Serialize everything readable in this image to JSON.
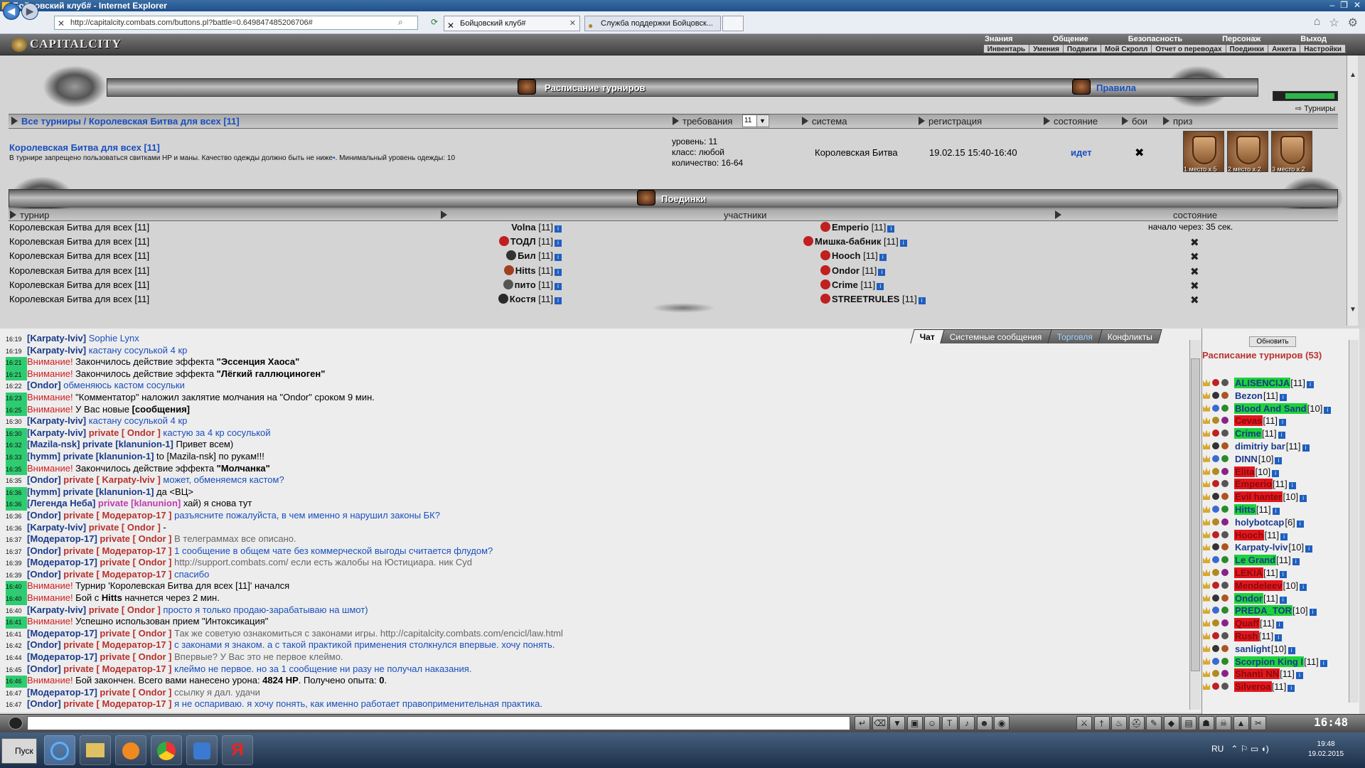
{
  "window": {
    "title": "Бойцовский клуб# - Internet Explorer",
    "controls": [
      "–",
      "❐",
      "✕"
    ]
  },
  "browser": {
    "url": "http://capitalcity.combats.com/buttons.pl?battle=0.649847485206706#",
    "tabs": [
      {
        "label": "Бойцовский клуб#",
        "close": "✕"
      },
      {
        "label": "Служба поддержки Бойцовск..."
      }
    ],
    "icons": [
      "back-icon",
      "forward-icon",
      "home-icon",
      "favorites-icon",
      "settings-icon"
    ]
  },
  "game": {
    "logo": "CAPITALCITY",
    "menu_top": [
      "Знания",
      "Общение",
      "Безопасность",
      "Персонаж",
      "Выход"
    ],
    "menu_sub": [
      "Инвентарь",
      "Умения",
      "Подвиги",
      "Мой Скролл",
      "Отчет о переводах",
      "Поединки",
      "Анкета",
      "Настройки"
    ],
    "schedule_title": "Расписание турниров",
    "rules": "Правила",
    "tournaments_link": "Турниры",
    "progress": 0.78,
    "header": {
      "crumb": "Все турниры / Королевская Битва для всех [11]",
      "requirements": "требования",
      "req_value": "11",
      "system": "система",
      "registration": "регистрация",
      "state": "состояние",
      "battles": "бои",
      "prize": "приз"
    },
    "tournament": {
      "name": "Королевская Битва для всех [11]",
      "desc": "В турнире запрещено пользоваться свитками HP и маны. Качество одежды должно быть не ниже",
      "desc2": ". Минимальный уровень одежды: 10",
      "level": "уровень: 11",
      "class": "класс: любой",
      "count": "количество: 16-64",
      "system": "Королевская Битва",
      "registration": "19.02.15 15:40-16:40",
      "state": "идет",
      "prizes": [
        "1 место",
        "2 место",
        "3 место"
      ],
      "prize_counts": [
        "x 5",
        "x 2",
        "x 2"
      ]
    },
    "duels": {
      "title": "Поединки",
      "headers": {
        "tournament": "турнир",
        "participants": "участники",
        "state": "состояние"
      },
      "rows": [
        {
          "t": "Королевская Битва для всех [11]",
          "a": "Volna",
          "al": "[11]",
          "b": "Emperio",
          "bl": "[11]",
          "state": "начало через: 35 сек."
        },
        {
          "t": "Королевская Битва для всех [11]",
          "a": "ТОДЛ",
          "al": "[11]",
          "b": "Мишка-бабник",
          "bl": "[11]",
          "state": "✖"
        },
        {
          "t": "Королевская Битва для всех [11]",
          "a": "Бил",
          "al": "[11]",
          "b": "Hooch",
          "bl": "[11]",
          "state": "✖"
        },
        {
          "t": "Королевская Битва для всех [11]",
          "a": "Hitts",
          "al": "[11]",
          "b": "Ondor",
          "bl": "[11]",
          "state": "✖"
        },
        {
          "t": "Королевская Битва для всех [11]",
          "a": "пито",
          "al": "[11]",
          "b": "Crime",
          "bl": "[11]",
          "state": "✖"
        },
        {
          "t": "Королевская Битва для всех [11]",
          "a": "Костя",
          "al": "[11]",
          "b": "STREETRULES",
          "bl": "[11]",
          "state": "✖"
        }
      ]
    }
  },
  "chat": {
    "tabs": [
      "Чат",
      "Системные сообщения",
      "Торговля",
      "Конфликты"
    ],
    "lines": [
      {
        "ts": "16:19",
        "hl": false,
        "parts": [
          [
            "nick",
            "[Karpaty-lviv]"
          ],
          [
            "bl",
            " Sophie Lynx"
          ]
        ]
      },
      {
        "ts": "16:19",
        "hl": false,
        "parts": [
          [
            "nick",
            "[Karpaty-lviv]"
          ],
          [
            "bl",
            " кастану сосулькой 4 кр"
          ]
        ]
      },
      {
        "ts": "16:21",
        "hl": true,
        "parts": [
          [
            "warn",
            "Внимание!"
          ],
          [
            "t",
            " Закончилось действие эффекта "
          ],
          [
            "bold",
            "\"Эссенция Хаоса\""
          ]
        ]
      },
      {
        "ts": "16:21",
        "hl": true,
        "parts": [
          [
            "warn",
            "Внимание!"
          ],
          [
            "t",
            " Закончилось действие эффекта "
          ],
          [
            "bold",
            "\"Лёгкий галлюциноген\""
          ]
        ]
      },
      {
        "ts": "16:22",
        "hl": false,
        "parts": [
          [
            "nick",
            "[Ondor]"
          ],
          [
            "bl",
            " обменяюсь кастом сосульки"
          ]
        ]
      },
      {
        "ts": "16:23",
        "hl": true,
        "parts": [
          [
            "warn",
            "Внимание!"
          ],
          [
            "t",
            " \"Комментатор\" наложил заклятие молчания на \"Ondor\" сроком 9 мин."
          ]
        ]
      },
      {
        "ts": "16:25",
        "hl": true,
        "parts": [
          [
            "warn",
            "Внимание!"
          ],
          [
            "t",
            " У Вас новые "
          ],
          [
            "bold",
            "[сообщения]"
          ]
        ]
      },
      {
        "ts": "16:30",
        "hl": false,
        "parts": [
          [
            "nick",
            "[Karpaty-lviv]"
          ],
          [
            "bl",
            " кастану сосулькой 4 кр"
          ]
        ]
      },
      {
        "ts": "16:30",
        "hl": true,
        "parts": [
          [
            "nick",
            "[Karpaty-lviv]"
          ],
          [
            "pnick",
            " private [ Ondor ]"
          ],
          [
            "bl",
            " кастую за 4 кр сосулькой"
          ]
        ]
      },
      {
        "ts": "16:32",
        "hl": true,
        "parts": [
          [
            "nick",
            "[Mazila-nsk]"
          ],
          [
            "nick",
            " private [klanunion-1]"
          ],
          [
            "t",
            " Привет всем)"
          ]
        ]
      },
      {
        "ts": "16:33",
        "hl": true,
        "parts": [
          [
            "nick",
            "[hymm]"
          ],
          [
            "nick",
            " private [klanunion-1]"
          ],
          [
            "t",
            " to [Mazila-nsk] по рукам!!!"
          ]
        ]
      },
      {
        "ts": "16:35",
        "hl": true,
        "parts": [
          [
            "warn",
            "Внимание!"
          ],
          [
            "t",
            " Закончилось действие эффекта "
          ],
          [
            "bold",
            "\"Молчанка\""
          ]
        ]
      },
      {
        "ts": "16:35",
        "hl": false,
        "parts": [
          [
            "nick",
            "[Ondor]"
          ],
          [
            "pnick",
            " private [ Karpaty-lviv ]"
          ],
          [
            "bl",
            " может, обменяемся кастом?"
          ]
        ]
      },
      {
        "ts": "16:36",
        "hl": true,
        "parts": [
          [
            "nick",
            "[hymm]"
          ],
          [
            "nick",
            " private [klanunion-1]"
          ],
          [
            "t",
            " да <ВЦ>"
          ]
        ]
      },
      {
        "ts": "16:36",
        "hl": true,
        "parts": [
          [
            "nick",
            "[Легенда Неба]"
          ],
          [
            "pink",
            " private [klanunion]"
          ],
          [
            "t",
            " хай) я снова тут"
          ]
        ]
      },
      {
        "ts": "16:36",
        "hl": false,
        "parts": [
          [
            "nick",
            "[Ondor]"
          ],
          [
            "pnick",
            " private [ Модератор-17 ]"
          ],
          [
            "bl",
            " разъясните пожалуйста, в чем именно я нарушил законы БК?"
          ]
        ]
      },
      {
        "ts": "16:36",
        "hl": false,
        "parts": [
          [
            "nick",
            "[Karpaty-lviv]"
          ],
          [
            "pnick",
            " private [ Ondor ]"
          ],
          [
            "t",
            " -"
          ]
        ]
      },
      {
        "ts": "16:37",
        "hl": false,
        "parts": [
          [
            "nick",
            "[Модератор-17]"
          ],
          [
            "pnick",
            " private [ Ondor ]"
          ],
          [
            "gray",
            " В телеграммах все описано."
          ]
        ]
      },
      {
        "ts": "16:37",
        "hl": false,
        "parts": [
          [
            "nick",
            "[Ondor]"
          ],
          [
            "pnick",
            " private [ Модератор-17 ]"
          ],
          [
            "bl",
            " 1 сообщение в общем чате без коммерческой выгоды считается флудом?"
          ]
        ]
      },
      {
        "ts": "16:39",
        "hl": false,
        "parts": [
          [
            "nick",
            "[Модератор-17]"
          ],
          [
            "pnick",
            " private [ Ondor ]"
          ],
          [
            "gray",
            " http://support.combats.com/ если есть жалобы на Юстициара. ник Cyd"
          ]
        ]
      },
      {
        "ts": "16:39",
        "hl": false,
        "parts": [
          [
            "nick",
            "[Ondor]"
          ],
          [
            "pnick",
            " private [ Модератор-17 ]"
          ],
          [
            "bl",
            " спасибо"
          ]
        ]
      },
      {
        "ts": "16:40",
        "hl": true,
        "parts": [
          [
            "warn",
            "Внимание!"
          ],
          [
            "t",
            " Турнир 'Королевская Битва для всех [11]' начался"
          ]
        ]
      },
      {
        "ts": "16:40",
        "hl": true,
        "parts": [
          [
            "warn",
            "Внимание!"
          ],
          [
            "t",
            " Бой с "
          ],
          [
            "bold",
            "Hitts"
          ],
          [
            "t",
            " начнется через 2 мин."
          ]
        ]
      },
      {
        "ts": "16:40",
        "hl": false,
        "parts": [
          [
            "nick",
            "[Karpaty-lviv]"
          ],
          [
            "pnick",
            " private [ Ondor ]"
          ],
          [
            "bl",
            " просто я только продаю-зарабатываю на шмот)"
          ]
        ]
      },
      {
        "ts": "16:41",
        "hl": true,
        "parts": [
          [
            "warn",
            "Внимание!"
          ],
          [
            "t",
            " Успешно использован прием \"Интоксикация\""
          ]
        ]
      },
      {
        "ts": "16:41",
        "hl": false,
        "parts": [
          [
            "nick",
            "[Модератор-17]"
          ],
          [
            "pnick",
            " private [ Ondor ]"
          ],
          [
            "gray",
            " Так же советую ознакомиться с законами игры. http://capitalcity.combats.com/encicl/law.html"
          ]
        ]
      },
      {
        "ts": "16:42",
        "hl": false,
        "parts": [
          [
            "nick",
            "[Ondor]"
          ],
          [
            "pnick",
            " private [ Модератор-17 ]"
          ],
          [
            "bl",
            " с законами я знаком. а с такой практикой применения столкнулся впервые. хочу понять."
          ]
        ]
      },
      {
        "ts": "16:44",
        "hl": false,
        "parts": [
          [
            "nick",
            "[Модератор-17]"
          ],
          [
            "pnick",
            " private [ Ondor ]"
          ],
          [
            "gray",
            " Впервые? У Вас это не первое клеймо."
          ]
        ]
      },
      {
        "ts": "16:45",
        "hl": false,
        "parts": [
          [
            "nick",
            "[Ondor]"
          ],
          [
            "pnick",
            " private [ Модератор-17 ]"
          ],
          [
            "bl",
            " клеймо не первое. но за 1 сообщение ни разу не получал наказания."
          ]
        ]
      },
      {
        "ts": "16:46",
        "hl": true,
        "parts": [
          [
            "warn",
            "Внимание!"
          ],
          [
            "t",
            " Бой закончен. Всего вами нанесено урона: "
          ],
          [
            "bold",
            "4824 HP"
          ],
          [
            "t",
            ". Получено опыта: "
          ],
          [
            "bold",
            "0"
          ],
          [
            "t",
            "."
          ]
        ]
      },
      {
        "ts": "16:47",
        "hl": false,
        "parts": [
          [
            "nick",
            "[Модератор-17]"
          ],
          [
            "pnick",
            " private [ Ondor ]"
          ],
          [
            "gray",
            " ссылку я дал. удачи"
          ]
        ]
      },
      {
        "ts": "16:47",
        "hl": false,
        "parts": [
          [
            "nick",
            "[Ondor]"
          ],
          [
            "pnick",
            " private [ Модератор-17 ]"
          ],
          [
            "bl",
            " я не оспариваю. я хочу понять, как именно работает правоприменительная практика."
          ]
        ]
      }
    ]
  },
  "rpanel": {
    "refresh": "Обновить",
    "title": "Расписание турниров (53)",
    "players": [
      {
        "n": "ALISENCIJA",
        "l": "[11]",
        "c": "g"
      },
      {
        "n": "Bezon",
        "l": "[11]",
        "c": ""
      },
      {
        "n": "Blood And Sand",
        "l": "[10]",
        "c": "g"
      },
      {
        "n": "Cevas",
        "l": "[11]",
        "c": "r"
      },
      {
        "n": "Crime",
        "l": "[11]",
        "c": "g"
      },
      {
        "n": "dimitriy bar",
        "l": "[11]",
        "c": ""
      },
      {
        "n": "DINN",
        "l": "[10]",
        "c": ""
      },
      {
        "n": "Elita",
        "l": "[10]",
        "c": "r"
      },
      {
        "n": "Emperio",
        "l": "[11]",
        "c": "r"
      },
      {
        "n": "Evil hanter",
        "l": "[10]",
        "c": "r"
      },
      {
        "n": "Hitts",
        "l": "[11]",
        "c": "g"
      },
      {
        "n": "holybotcap",
        "l": "[6]",
        "c": ""
      },
      {
        "n": "Hooch",
        "l": "[11]",
        "c": "r"
      },
      {
        "n": "Karpaty-lviv",
        "l": "[10]",
        "c": ""
      },
      {
        "n": "Le Grand",
        "l": "[11]",
        "c": "g"
      },
      {
        "n": "LEKIA",
        "l": "[11]",
        "c": "r"
      },
      {
        "n": "Mendeleev",
        "l": "[10]",
        "c": "r"
      },
      {
        "n": "Ondor",
        "l": "[11]",
        "c": "g"
      },
      {
        "n": "PREDA_TOR",
        "l": "[10]",
        "c": "g"
      },
      {
        "n": "Quaff",
        "l": "[11]",
        "c": "r"
      },
      {
        "n": "Rush",
        "l": "[11]",
        "c": "r"
      },
      {
        "n": "sanlight",
        "l": "[10]",
        "c": ""
      },
      {
        "n": "Scorpion King I",
        "l": "[11]",
        "c": "g"
      },
      {
        "n": "Shanti NN",
        "l": "[11]",
        "c": "r"
      },
      {
        "n": "Silveroa",
        "l": "[11]",
        "c": "r"
      }
    ]
  },
  "toolbar": {
    "clock": "16:48"
  },
  "taskbar": {
    "start": "Пуск",
    "lang": "RU",
    "time": "19:48",
    "date": "19.02.2015"
  }
}
